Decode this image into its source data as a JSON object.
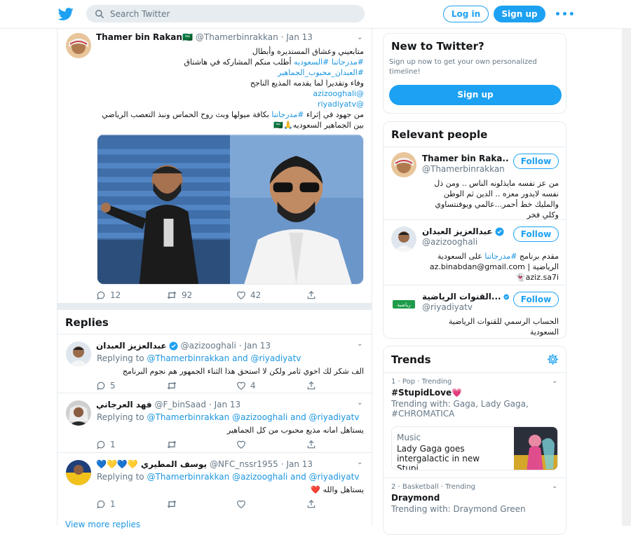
{
  "topbar": {
    "search_placeholder": "Search Twitter",
    "login_label": "Log in",
    "signup_label": "Sign up",
    "more_label": "•••"
  },
  "tweet": {
    "name": "Thamer bin Rakan🇸🇦",
    "handle": "@Thamerbinrakkan",
    "date": "· Jan 13",
    "lines": [
      "متابعيني وعشاق المستديره وأبطال",
      "أطلب منكم المشاركه في هاشتاق",
      "وفاء وتقديرا لما يقدمه المذيع الناجح",
      "من جهود في إثراء",
      "بكافة ميولها وبث روح الحماس ونبذ التعصب الرياضي",
      "بين الجماهير السعوديه🙏🇸🇦"
    ],
    "hashtag1": "#مدرجاتنا",
    "hashtag2": "#السعوديه",
    "hashtag3": "#العبدان_محبوب_الجماهير",
    "mention1": "@azizooghali",
    "mention2": "@riyadiyatv",
    "hashtag4": "#مدرجاتنا",
    "replies": "12",
    "retweets": "92",
    "likes": "42"
  },
  "replies_section": {
    "title": "Replies",
    "items": [
      {
        "name": "عبدالعزيز العبدان",
        "handle": "@azizooghali",
        "date": "· Jan 13",
        "replying_prefix": "Replying to",
        "replying_to": "@Thamerbinrakkan and @riyadiyatv",
        "text": "الف شكر لك اخوي ثامر  ولكن لا استحق هذا الثناء الجمهور هم نجوم البرنامج",
        "replies": "5",
        "retweets": "",
        "likes": "4"
      },
      {
        "name": "فهد العرجاني",
        "handle": "@F_binSaad",
        "date": "· Jan 13",
        "replying_prefix": "Replying to",
        "replying_to": "@Thamerbinrakkan @azizooghali and @riyadiyatv",
        "text": "يستاهل امانه مذيع محبوب من كل الجماهير",
        "replies": "1",
        "retweets": "",
        "likes": ""
      },
      {
        "name": "💙💛💙💛 يوسف المطيري",
        "handle": "@NFC_nssr1955",
        "date": "· Jan 13",
        "replying_prefix": "Replying to",
        "replying_to": "@Thamerbinrakkan @azizooghali and @riyadiyatv",
        "text": "يستاهل والله ❤️",
        "replies": "1",
        "retweets": "",
        "likes": ""
      }
    ],
    "view_more": "View more replies"
  },
  "new_to_twitter": {
    "title": "New to Twitter?",
    "subtitle": "Sign up now to get your own personalized timeline!",
    "button": "Sign up"
  },
  "relevant_people": {
    "title": "Relevant people",
    "follow_label": "Follow",
    "people": [
      {
        "name": "Thamer bin Raka...",
        "handle": "@Thamerbinrakkan",
        "bio": "من عز نفسه مايذلونه الناس .. ومن ذل نفسه لايدور معزه .. الدين ثم الوطن والمليك خط أحمر...عالمي ويوفنتساوي وكلي فخر"
      },
      {
        "name": "عبدالعزيز العبدان",
        "handle": "@azizooghali",
        "bio_pre": "مقدم برنامج",
        "bio_tag": "#مدرجاتنا",
        "bio_post": "على السعودية الرياضية | az.binabdan@gmail.com 👻aziz.sa7i"
      },
      {
        "name": "القنوات الرياضية...",
        "handle": "@riyadiyatv",
        "bio": "الحساب الرسمي للقنوات الرياضية السعودية"
      }
    ]
  },
  "trends": {
    "title": "Trends",
    "items": [
      {
        "meta": "1 · Pop · Trending",
        "name": "#StupidLove💗",
        "with": "Trending with: Gaga, Lady Gaga, #CHROMATICA",
        "card_category": "Music",
        "card_headline": "Lady Gaga goes intergalactic in new Stupi..."
      },
      {
        "meta": "2 · Basketball · Trending",
        "name": "Draymond",
        "with": "Trending with: Draymond Green"
      }
    ]
  },
  "colors": {
    "accent": "#1da1f2",
    "link": "#1b95e0",
    "muted": "#657786",
    "border": "#e6ecf0"
  }
}
